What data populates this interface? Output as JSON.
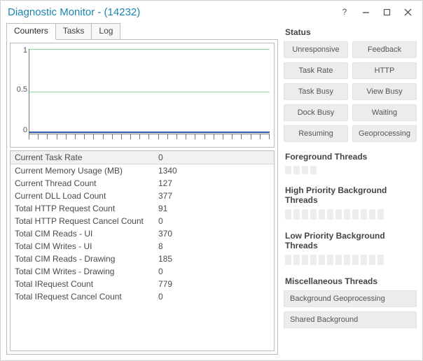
{
  "window": {
    "title": "Diagnostic Monitor - (14232)"
  },
  "tabs": [
    "Counters",
    "Tasks",
    "Log"
  ],
  "active_tab": 0,
  "chart_data": {
    "type": "line",
    "ylim": [
      0,
      1
    ],
    "yticks": [
      0,
      0.5,
      1
    ],
    "series": [
      {
        "name": "Current Task Rate",
        "value": 0
      }
    ],
    "x_tick_count": 27
  },
  "counters": [
    {
      "k": "Current Task Rate",
      "v": "0"
    },
    {
      "k": "Current Memory Usage (MB)",
      "v": "1340"
    },
    {
      "k": "Current Thread Count",
      "v": "127"
    },
    {
      "k": "Current DLL Load Count",
      "v": "377"
    },
    {
      "k": "Total HTTP Request Count",
      "v": "91"
    },
    {
      "k": "Total HTTP Request Cancel Count",
      "v": "0"
    },
    {
      "k": "Total CIM Reads - UI",
      "v": "370"
    },
    {
      "k": "Total CIM Writes - UI",
      "v": "8"
    },
    {
      "k": "Total CIM Reads - Drawing",
      "v": "185"
    },
    {
      "k": "Total CIM Writes - Drawing",
      "v": "0"
    },
    {
      "k": "Total IRequest Count",
      "v": "779"
    },
    {
      "k": "Total IRequest Cancel Count",
      "v": "0"
    }
  ],
  "status": {
    "title": "Status",
    "buttons": [
      "Unresponsive",
      "Feedback",
      "Task Rate",
      "HTTP",
      "Task Busy",
      "View Busy",
      "Dock Busy",
      "Waiting",
      "Resuming",
      "Geoprocessing"
    ]
  },
  "threads": {
    "foreground": {
      "title": "Foreground Threads",
      "count": 4
    },
    "high": {
      "title": "High Priority Background Threads",
      "count": 12
    },
    "low": {
      "title": "Low Priority Background Threads",
      "count": 12
    },
    "misc": {
      "title": "Miscellaneous Threads",
      "buttons": [
        "Background Geoprocessing",
        "Shared Background"
      ]
    }
  }
}
